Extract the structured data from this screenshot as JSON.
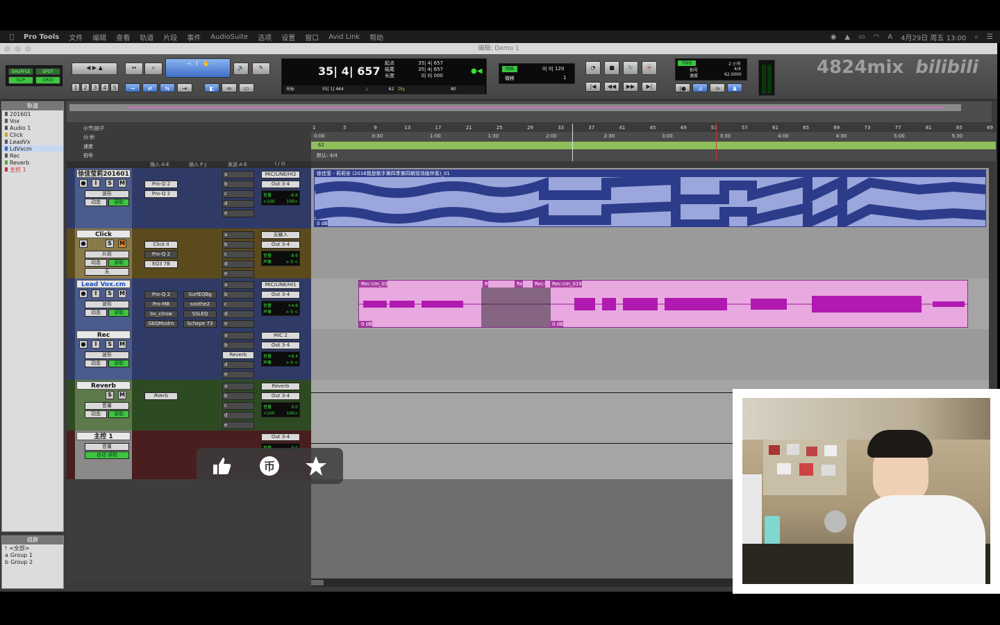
{
  "menubar": {
    "apple": "",
    "items": [
      "Pro Tools",
      "文件",
      "编辑",
      "查看",
      "轨道",
      "片段",
      "事件",
      "AudioSuite",
      "选项",
      "设置",
      "窗口",
      "Avid Link",
      "帮助"
    ],
    "clock": "4月29日 周五 13:00"
  },
  "window": {
    "title": "编辑: Demo 1"
  },
  "toolbar": {
    "modes": [
      "SHUFFLE",
      "SPOT",
      "SLIP",
      "GRID"
    ],
    "zoom_presets": [
      "1",
      "2",
      "3",
      "4",
      "5"
    ],
    "counter_main": "35| 4| 657",
    "start_label": "起点",
    "end_label": "结尾",
    "length_label": "长度",
    "start_val": "35| 4| 657",
    "end_val": "35| 4| 657",
    "length_val": "0| 0| 000",
    "cursor_label": "光标",
    "cursor_val": "55| 1| 464",
    "nudge_val": "62",
    "dly_label": "Dly",
    "zoom_val": "80",
    "grid_label": "网格",
    "grid_val": "0| 0| 120",
    "nudge_label": "微移",
    "nudge_num": "1",
    "count_label": "预备拍",
    "count_bars": "2 小节",
    "meter_label": "拍号",
    "meter_val": "4/4",
    "tempo_label": "速度",
    "tempo_val": "62.0000"
  },
  "watermark": "4824mix",
  "brand": "bilibili",
  "tracklist": {
    "header": "轨道",
    "items": [
      "201601",
      "Vox",
      "Audio 1",
      "Click",
      "LeadVx",
      "LdVxcm",
      "Rec",
      "Reverb",
      "主控 1"
    ]
  },
  "groups": {
    "header": "组群",
    "items": [
      "<全部>",
      "Group 1",
      "Group 2"
    ],
    "letters": [
      "!",
      "a",
      "b"
    ]
  },
  "ruler": {
    "rows": [
      "小节|拍子",
      "分:秒",
      "速度",
      "拍号"
    ],
    "bars": [
      "1",
      "5",
      "9",
      "13",
      "17",
      "21",
      "25",
      "29",
      "33",
      "37",
      "41",
      "45",
      "49",
      "53",
      "57",
      "61",
      "65",
      "69",
      "73",
      "77",
      "81",
      "85",
      "89"
    ],
    "times": [
      "0:00",
      "0:30",
      "1:00",
      "1:30",
      "2:00",
      "2:30",
      "3:00",
      "3:30",
      "4:00",
      "4:30",
      "5:00",
      "5:30"
    ],
    "tempo_marker": "62",
    "meter_marker": "默认: 4/4"
  },
  "mix_columns": [
    "插入 A-E",
    "插入 F-J",
    "发送 A-E",
    "I / O"
  ],
  "tracks": [
    {
      "name": "徐佳莹莉201601",
      "view": "波形",
      "auto": "动态",
      "read": "读取",
      "inserts": [
        "Pro-Q 2",
        "Pro-Q 2"
      ],
      "sends": [
        "a",
        "b",
        "c",
        "d",
        "e"
      ],
      "input": "MIC/LINE/HI2",
      "output": "Out 3-4",
      "vol_label": "音量",
      "vol_val": "-6.6",
      "pan_l": "<100",
      "pan_r": "100>",
      "clip_name": "徐佳莹 - 莉莉安 (2016我是歌手第四季第四期现场版伴奏)_01",
      "clip_gain": "0 dB",
      "color": "#2d3c8a"
    },
    {
      "name": "Click",
      "view": "片段",
      "auto": "动态",
      "read": "读取",
      "extra": "无",
      "inserts": [
        "Click II",
        "Pro-Q 2",
        "EQ3 7B"
      ],
      "sends": [
        "a",
        "b",
        "c",
        "d",
        "e"
      ],
      "input": "无输入",
      "output": "Out 3-4",
      "vol_label": "音量",
      "vol_val": "-8.6",
      "pan_label": "声像",
      "pan_val": "> 0 <",
      "color": "#d4a21f"
    },
    {
      "name": "Lead Vox.cm",
      "view": "波形",
      "auto": "动态",
      "read": "读取",
      "inserts": [
        "Pro-Q 2",
        "Pro-MB",
        "bx_clnsw",
        "GEQModrn"
      ],
      "inserts2": [
        "SurfEQBg",
        "soothe2",
        "SSLEQ",
        "Schepe 73"
      ],
      "sends": [
        "a",
        "b",
        "c",
        "d",
        "e"
      ],
      "input": "MIC/LINE/HI1",
      "output": "Out 3-4",
      "vol_label": "音量",
      "vol_val": "+4.8",
      "pan_label": "声像",
      "pan_val": "> 0 <",
      "clip1": "Rec-cm_03",
      "clip2": "R",
      "clip3": "Re",
      "clip4": "Rec-",
      "clip5": "Rec-cm_019",
      "clip_gain1": "0 dB",
      "clip_gain2": "0 dB",
      "color": "#3a66c8"
    },
    {
      "name": "Rec",
      "view": "波形",
      "auto": "动态",
      "read": "读取",
      "sends": [
        "a",
        "b",
        "c",
        "d",
        "e"
      ],
      "send_named": "Reverb",
      "input": "MIC 2",
      "output": "Out 3-4",
      "vol_label": "音量",
      "vol_val": "+8.4",
      "pan_label": "声像",
      "pan_val": "> 0 <",
      "color": "#3a66c8"
    },
    {
      "name": "Reverb",
      "view": "音量",
      "auto": "动态",
      "read": "读取",
      "inserts": [
        "RVerb"
      ],
      "sends": [
        "a",
        "b",
        "c",
        "d",
        "e"
      ],
      "input": "Reverb",
      "output": "Out 3-4",
      "vol_label": "音量",
      "vol_val": "0.0",
      "pan_l": "<100",
      "pan_r": "100>",
      "color": "#5aa832"
    },
    {
      "name": "主控 1",
      "view": "音量",
      "auto": "自动 读取",
      "output": "Out 3-4",
      "vol_label": "音量",
      "vol_val": "0.0",
      "color": "#c43030"
    }
  ],
  "social": {
    "like": "like-icon",
    "coin": "coin-icon",
    "fav": "star-icon"
  }
}
